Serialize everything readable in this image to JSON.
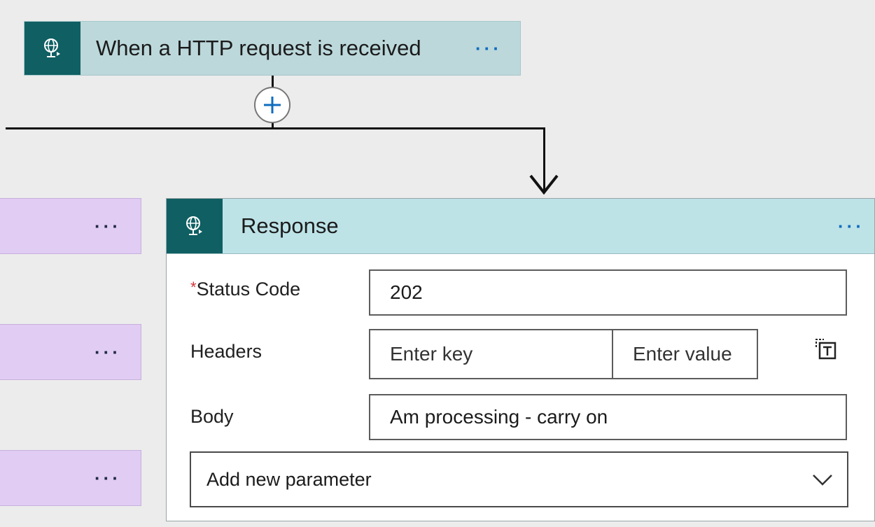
{
  "trigger": {
    "title": "When a HTTP request is received",
    "more_label": "···",
    "icon": "globe-request-icon"
  },
  "add_step": {
    "icon": "plus-icon"
  },
  "branches": [
    {
      "more_label": "···"
    },
    {
      "more_label": "···"
    },
    {
      "more_label": "···"
    }
  ],
  "response": {
    "title": "Response",
    "more_label": "···",
    "icon": "globe-request-icon",
    "status_code": {
      "required_marker": "*",
      "label": "Status Code",
      "value": "202"
    },
    "headers": {
      "label": "Headers",
      "key_placeholder": "Enter key",
      "value_placeholder": "Enter value",
      "switch_icon": "text-mode-switch-icon"
    },
    "body": {
      "label": "Body",
      "value": "Am processing - carry on"
    },
    "add_parameter": {
      "label": "Add new parameter",
      "icon": "chevron-down-icon"
    }
  },
  "colors": {
    "canvas": "#ececec",
    "trigger_header": "#bcd8db",
    "response_header": "#bde3e7",
    "icon_bg": "#0f5f63",
    "branch_card": "#e1ccf3",
    "accent": "#0f6cbd",
    "required": "#d13438"
  }
}
